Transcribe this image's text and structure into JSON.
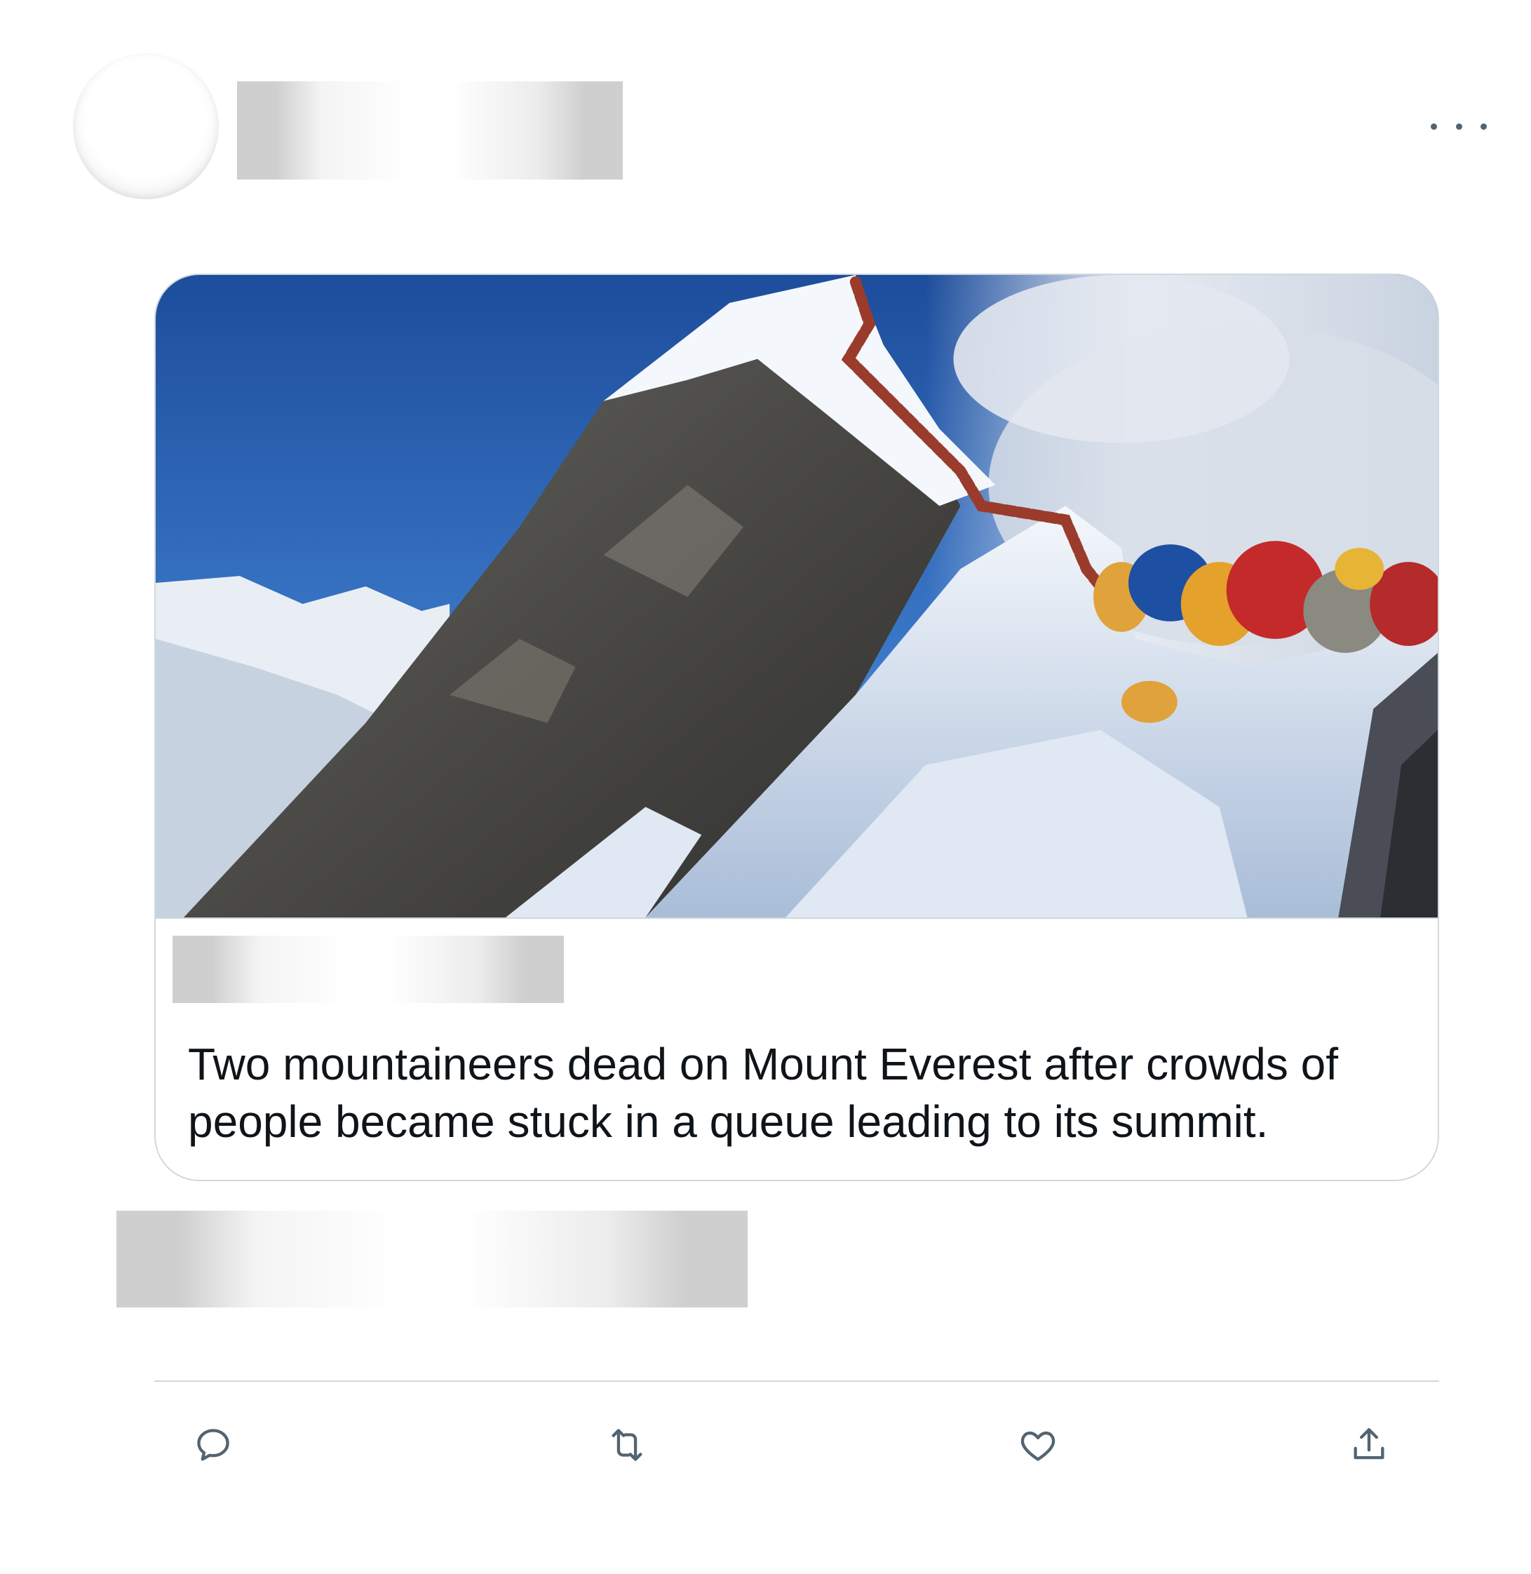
{
  "tweet": {
    "author": {
      "avatar": "redacted-avatar",
      "name": "redacted"
    },
    "more_icon": "more-horizontal-icon",
    "card": {
      "image": "mount-everest-summit-queue-photo",
      "source": "redacted",
      "title": "Two mountaineers dead on Mount Everest after crowds of people became stuck in a queue leading to its summit."
    },
    "timestamp": "redacted",
    "actions": [
      {
        "name": "reply",
        "icon": "reply-icon"
      },
      {
        "name": "retweet",
        "icon": "retweet-icon"
      },
      {
        "name": "like",
        "icon": "heart-icon"
      },
      {
        "name": "share",
        "icon": "share-icon"
      }
    ]
  },
  "colors": {
    "icon": "#536471",
    "border": "#cfd9de",
    "text": "#0f1419",
    "redaction": "#cfcfcf"
  }
}
